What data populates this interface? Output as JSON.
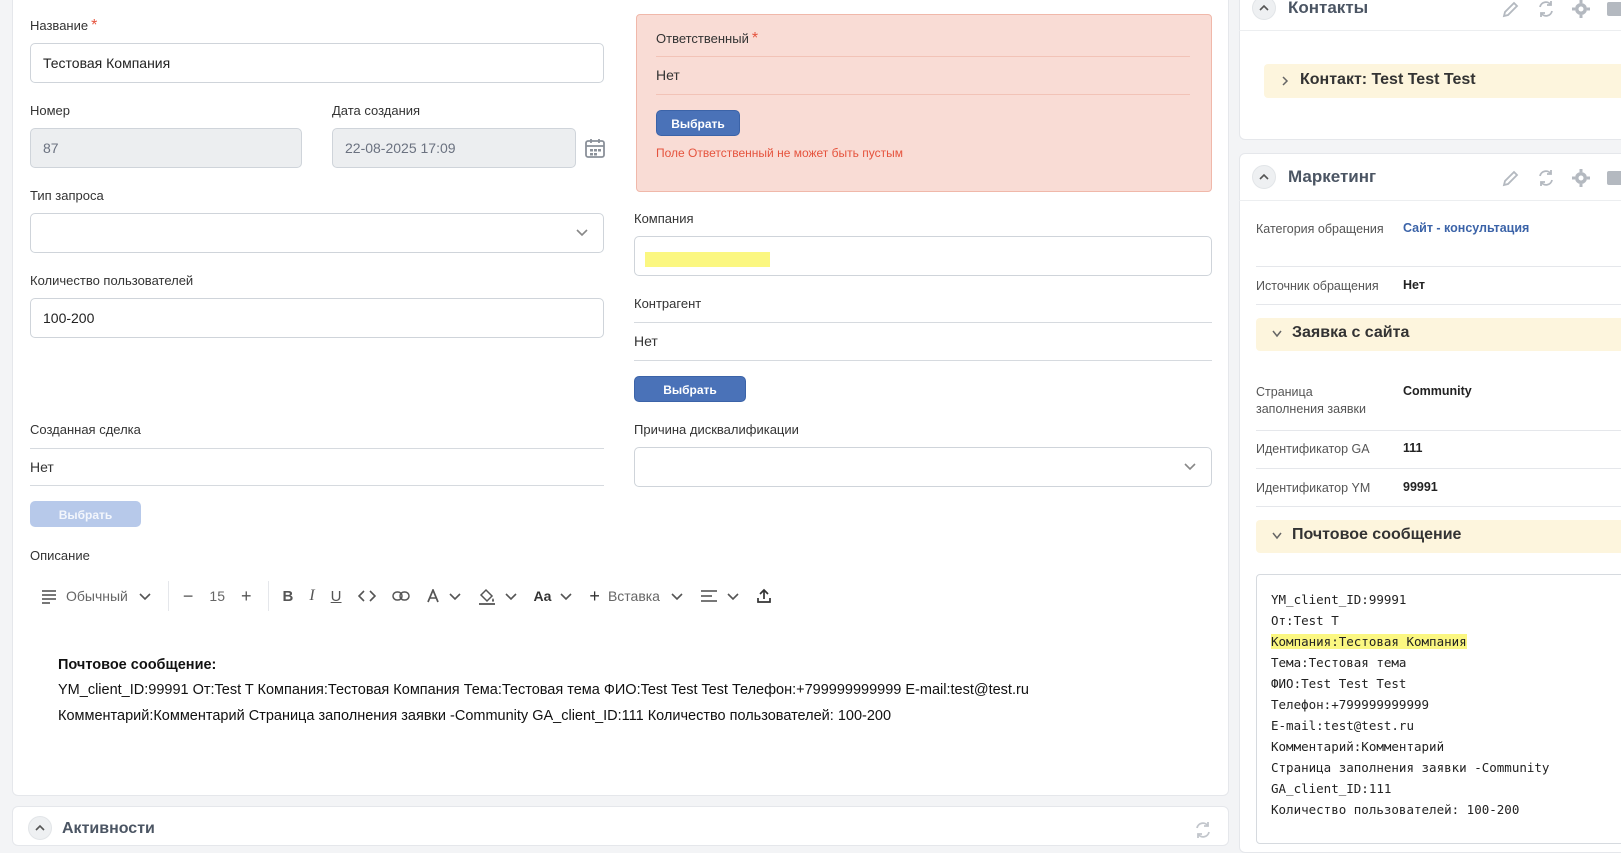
{
  "form": {
    "name_label": "Название",
    "name_value": "Тестовая Компания",
    "number_label": "Номер",
    "number_value": "87",
    "created_label": "Дата создания",
    "created_value": "22-08-2025 17:09",
    "request_type_label": "Тип запроса",
    "request_type_value": "",
    "users_label": "Количество пользователей",
    "users_value": "100-200",
    "deal_label": "Созданная сделка",
    "deal_value": "Нет",
    "deal_button": "Выбрать",
    "responsible_label": "Ответственный",
    "responsible_value": "Нет",
    "responsible_button": "Выбрать",
    "responsible_error": "Поле Ответственный не может быть пустым",
    "company_label": "Компания",
    "company_value": "",
    "counterparty_label": "Контрагент",
    "counterparty_value": "Нет",
    "counterparty_button": "Выбрать",
    "disq_label": "Причина дисквалификации",
    "disq_value": "",
    "required_mark": "*",
    "description_label": "Описание"
  },
  "toolbar": {
    "style": "Обычный",
    "font_size": "15",
    "minus": "−",
    "plus": "+",
    "case": "Aa",
    "insert_plus": "+",
    "insert": "Вставка"
  },
  "editor": {
    "heading": "Почтовое сообщение:",
    "line1": "YM_client_ID:99991 От:Test T Компания:Тестовая Компания Тема:Тестовая тема ФИО:Test Test Test Телефон:+799999999999 E-mail:test@test.ru",
    "line2": "Комментарий:Комментарий Страница заполнения заявки -Community GA_client_ID:111 Количество пользователей: 100-200"
  },
  "activities": {
    "title": "Активности"
  },
  "contacts": {
    "title": "Контакты",
    "contact_item": "Контакт: Test Test Test"
  },
  "marketing": {
    "title": "Маркетинг",
    "category_label": "Категория обращения",
    "category_value": "Сайт - консультация",
    "source_label": "Источник обращения",
    "source_value": "Нет",
    "site_request_title": "Заявка с сайта",
    "page_label": "Страница заполнения заявки",
    "page_value": "Community",
    "ga_label": "Идентификатор GA",
    "ga_value": "111",
    "ym_label": "Идентификатор YM",
    "ym_value": "99991",
    "mail_title": "Почтовое сообщение",
    "mail_lines": [
      "YM_client_ID:99991",
      "От:Test T",
      "Компания:Тестовая Компания",
      "Тема:Тестовая тема",
      "ФИО:Test Test Test",
      "Телефон:+799999999999",
      "E-mail:test@test.ru",
      "Комментарий:Комментарий",
      "Страница заполнения заявки -Community",
      "GA_client_ID:111",
      "Количество пользователей: 100-200"
    ]
  }
}
